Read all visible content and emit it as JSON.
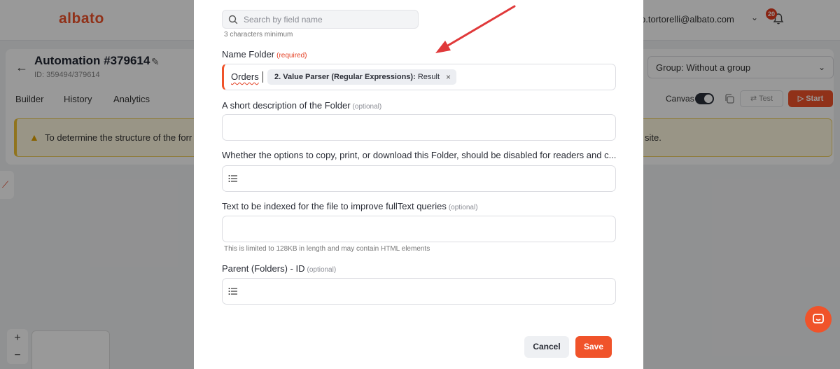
{
  "app": {
    "logo": "albato",
    "user_email": "p.tortorelli@albato.com",
    "notifications_count": "20",
    "automation_title": "Automation #379614",
    "automation_id": "ID: 359494/379614",
    "tabs": [
      "Builder",
      "History",
      "Analytics"
    ],
    "group_select": "Group: Without a group",
    "canvas_label": "Canvas",
    "test_label": "Test",
    "start_label": "Start",
    "notice_text_left": "To determine the structure of the forr",
    "notice_text_right": "site.",
    "zoom_in": "+",
    "zoom_out": "−"
  },
  "modal": {
    "search": {
      "placeholder": "Search by field name",
      "value": "",
      "hint": "3 characters minimum"
    },
    "fields": [
      {
        "label": "Name Folder",
        "tag": "(required)",
        "value_text": "Orders",
        "chip_bold": "2. Value Parser (Regular Expressions):",
        "chip_rest": "Result"
      },
      {
        "label": "A short description of the Folder",
        "tag": "(optional)"
      },
      {
        "label": "Whether the options to copy, print, or download this Folder, should be disabled for readers and c..."
      },
      {
        "label": "Text to be indexed for the file to improve fullText queries",
        "tag": "(optional)",
        "hint": "This is limited to 128KB in length and may contain HTML elements"
      },
      {
        "label": "Parent (Folders) - ID",
        "tag": "(optional)"
      }
    ],
    "cancel_label": "Cancel",
    "save_label": "Save"
  },
  "colors": {
    "accent": "#f0532a",
    "required": "#e33d20",
    "annotation_arrow": "#e0393a"
  }
}
